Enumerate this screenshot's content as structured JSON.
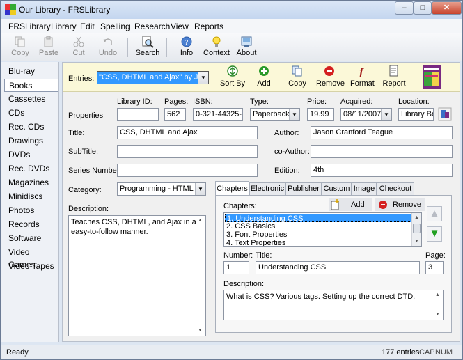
{
  "window": {
    "title": "Our Library - FRSLibrary",
    "minimize": "–",
    "maximize": "□",
    "close": "✕"
  },
  "menu": [
    "FRSLibrary",
    "Library",
    "Edit",
    "Spelling",
    "Research",
    "View",
    "Reports"
  ],
  "toolbar": {
    "copy": "Copy",
    "paste": "Paste",
    "cut": "Cut",
    "undo": "Undo",
    "search": "Search",
    "info": "Info",
    "context": "Context",
    "about": "About"
  },
  "sidebar": {
    "items": [
      "Blu-ray",
      "Books",
      "Cassettes",
      "CDs",
      "Rec. CDs",
      "Drawings",
      "DVDs",
      "Rec. DVDs",
      "Magazines",
      "Minidiscs",
      "Photos",
      "Records",
      "Software",
      "Video Games",
      "Video Tapes"
    ],
    "selected": "Books"
  },
  "entries": {
    "label": "Entries:",
    "selected": "\"CSS, DHTML and Ajax\" by Jaso",
    "buttons": {
      "sort_by": "Sort By",
      "add": "Add",
      "copy": "Copy",
      "remove": "Remove",
      "format": "Format",
      "report": "Report"
    },
    "cover_text": "DHTML & AJAX"
  },
  "properties": {
    "section_label": "Properties",
    "library_id_label": "Library ID:",
    "library_id": "",
    "pages_label": "Pages:",
    "pages": "562",
    "isbn_label": "ISBN:",
    "isbn": "0-321-44325-X",
    "type_label": "Type:",
    "type": "Paperback",
    "price_label": "Price:",
    "price": "19.99",
    "acquired_label": "Acquired:",
    "acquired": "08/11/2007",
    "location_label": "Location:",
    "location": "Library Boo"
  },
  "fields": {
    "title_label": "Title:",
    "title": "CSS, DHTML and Ajax",
    "author_label": "Author:",
    "author": "Jason Cranford Teague",
    "subtitle_label": "SubTitle:",
    "subtitle": "",
    "coauthor_label": "co-Author:",
    "coauthor": "",
    "series_label": "Series Number:",
    "series": "",
    "edition_label": "Edition:",
    "edition": "4th",
    "category_label": "Category:",
    "category": "Programming - HTML",
    "description_label": "Description:",
    "description": "Teaches CSS, DHTML, and Ajax in an easy-to-follow manner."
  },
  "tabs": [
    "Chapters",
    "Electronic",
    "Publisher",
    "Custom",
    "Image",
    "Checkout"
  ],
  "chapters": {
    "label": "Chapters:",
    "add": "Add",
    "remove": "Remove",
    "items": [
      "1. Understanding CSS",
      "2. CSS Basics",
      "3. Font Properties",
      "4. Text Properties"
    ],
    "number_label": "Number:",
    "number": "1",
    "title_label": "Title:",
    "title": "Understanding CSS",
    "page_label": "Page:",
    "page": "3",
    "description_label": "Description:",
    "description": "What is CSS? Various tags. Setting up the correct DTD."
  },
  "status": {
    "left": "Ready",
    "entries": "177 entries",
    "cap": "CAP",
    "num": "NUM"
  },
  "colors": {
    "selection": "#3399ff",
    "entries_bar": "#fbf8d8",
    "add_green": "#2a9a2a",
    "remove_red": "#d42020"
  }
}
